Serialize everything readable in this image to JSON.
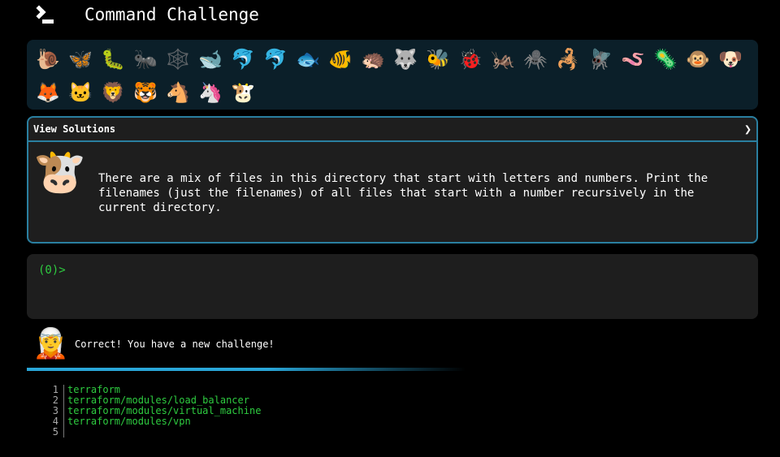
{
  "header": {
    "title": "Command Challenge"
  },
  "animals": [
    "🐌",
    "🦋",
    "🐛",
    "🐜",
    "🕸️",
    "🐋",
    "🐬",
    "🐬",
    "🐟",
    "🐠",
    "🦔",
    "🐺",
    "🐝",
    "🐞",
    "🦗",
    "🕷️",
    "🦂",
    "🪰",
    "🪱",
    "🦠",
    "🐵",
    "🐶",
    "🦊",
    "🐱",
    "🦁",
    "🐯",
    "🐴",
    "🦄",
    "🐮"
  ],
  "panel": {
    "header_label": "View Solutions",
    "avatar": "🐮",
    "challenge": "There are a mix of files in this directory that start with letters and numbers. Print the\nfilenames (just the filenames) of all files that start with a number recursively in the\ncurrent directory."
  },
  "terminal": {
    "prompt": "(0)>",
    "input_value": ""
  },
  "feedback": {
    "avatar": "🧝",
    "message": "Correct! You have a new challenge!"
  },
  "progress": 0.6,
  "output": {
    "line_numbers": [
      "1",
      "2",
      "3",
      "4",
      "5"
    ],
    "lines": [
      "terraform",
      "terraform/modules/load_balancer",
      "terraform/modules/virtual_machine",
      "terraform/modules/vpn",
      ""
    ]
  },
  "colors": {
    "accent": "#2a7fa0",
    "prompt": "#2ecc40",
    "progress": "#29a6d8"
  }
}
